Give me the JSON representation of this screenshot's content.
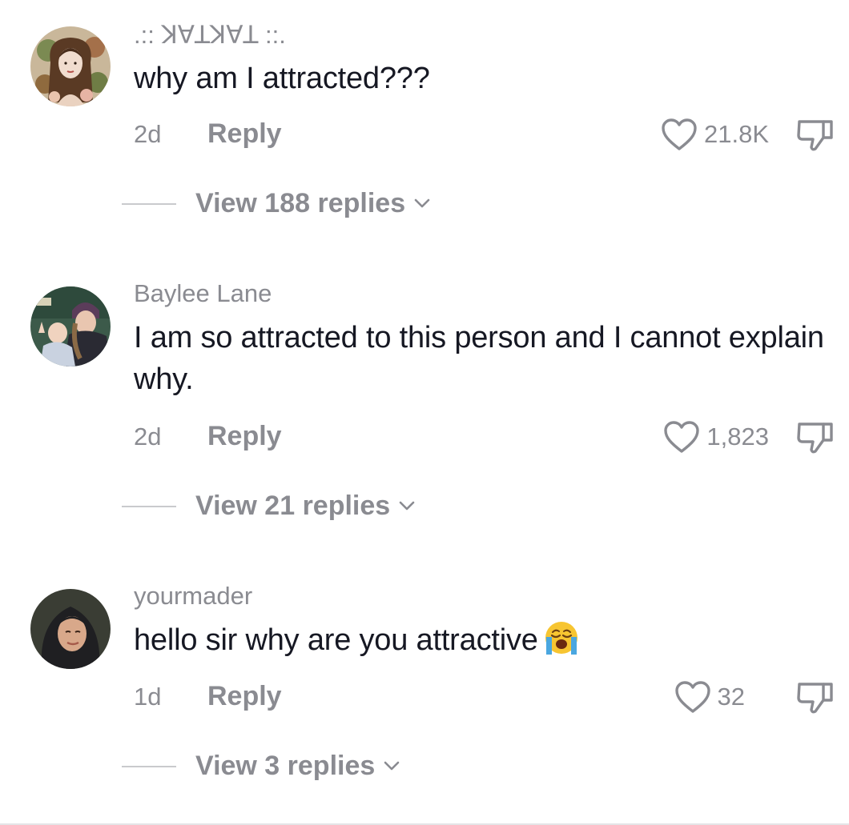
{
  "comments": [
    {
      "username": ".:: ꓘꓯꓕꓘꓯꓕ ::.",
      "text": "why am I attracted???",
      "time": "2d",
      "reply_label": "Reply",
      "likes": "21.8K",
      "view_replies": "View 188 replies"
    },
    {
      "username": "Baylee Lane",
      "text": "I am so attracted to this person and I cannot explain why.",
      "time": "2d",
      "reply_label": "Reply",
      "likes": "1,823",
      "view_replies": "View 21 replies"
    },
    {
      "username": "yourmader",
      "text": "hello sir why are you attractive",
      "emoji": "loudly-crying-face-emoji",
      "time": "1d",
      "reply_label": "Reply",
      "likes": "32",
      "view_replies": "View 3 replies"
    }
  ],
  "icons": {
    "like": "heart-outline-icon",
    "dislike": "thumbs-down-icon",
    "expand": "chevron-down-icon"
  },
  "colors": {
    "primary_text": "#161823",
    "secondary_text": "#8a8b91",
    "divider": "#c9cacd"
  }
}
